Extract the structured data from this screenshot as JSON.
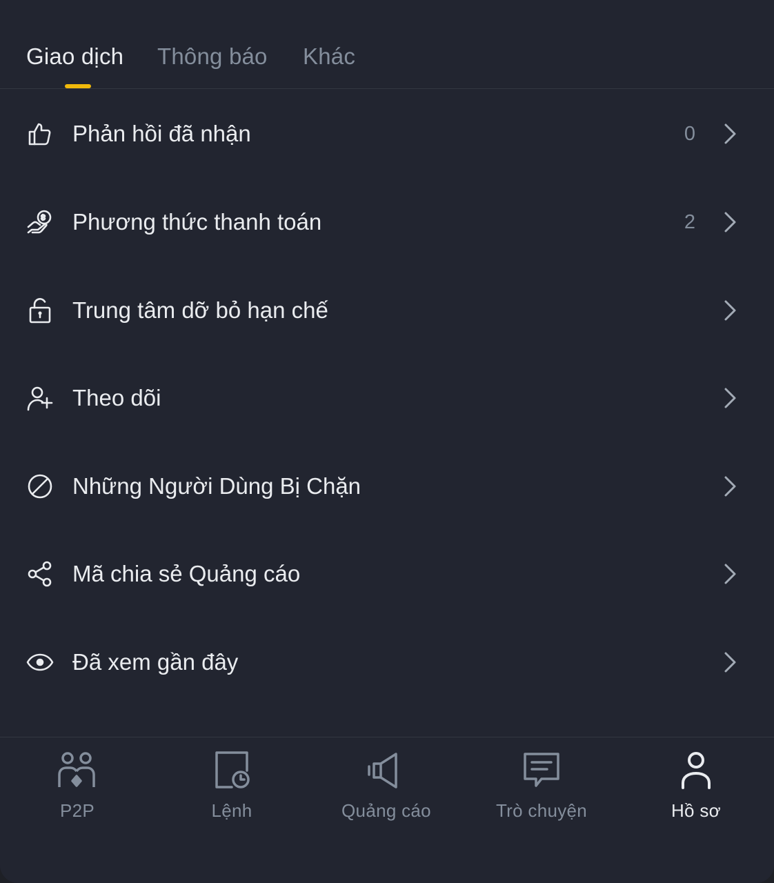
{
  "tabs": [
    {
      "label": "Giao dịch",
      "active": true
    },
    {
      "label": "Thông báo",
      "active": false
    },
    {
      "label": "Khác",
      "active": false
    }
  ],
  "menu": [
    {
      "icon": "thumbs-up-icon",
      "label": "Phản hồi đã nhận",
      "count": "0"
    },
    {
      "icon": "payment-hand-icon",
      "label": "Phương thức thanh toán",
      "count": "2"
    },
    {
      "icon": "unlock-icon",
      "label": "Trung tâm dỡ bỏ hạn chế",
      "count": ""
    },
    {
      "icon": "user-plus-icon",
      "label": "Theo dõi",
      "count": ""
    },
    {
      "icon": "block-icon",
      "label": "Những Người Dùng Bị Chặn",
      "count": ""
    },
    {
      "icon": "share-icon",
      "label": "Mã chia sẻ Quảng cáo",
      "count": ""
    },
    {
      "icon": "eye-icon",
      "label": "Đã xem gần đây",
      "count": ""
    }
  ],
  "bottom_nav": [
    {
      "icon": "p2p-icon",
      "label": "P2P",
      "active": false
    },
    {
      "icon": "orders-icon",
      "label": "Lệnh",
      "active": false
    },
    {
      "icon": "megaphone-icon",
      "label": "Quảng cáo",
      "active": false
    },
    {
      "icon": "chat-icon",
      "label": "Trò chuyện",
      "active": false
    },
    {
      "icon": "profile-icon",
      "label": "Hồ sơ",
      "active": true
    }
  ],
  "colors": {
    "background": "#222530",
    "text_primary": "#eaecef",
    "text_secondary": "#848e9c",
    "accent": "#f0b90b",
    "divider": "#333741"
  }
}
